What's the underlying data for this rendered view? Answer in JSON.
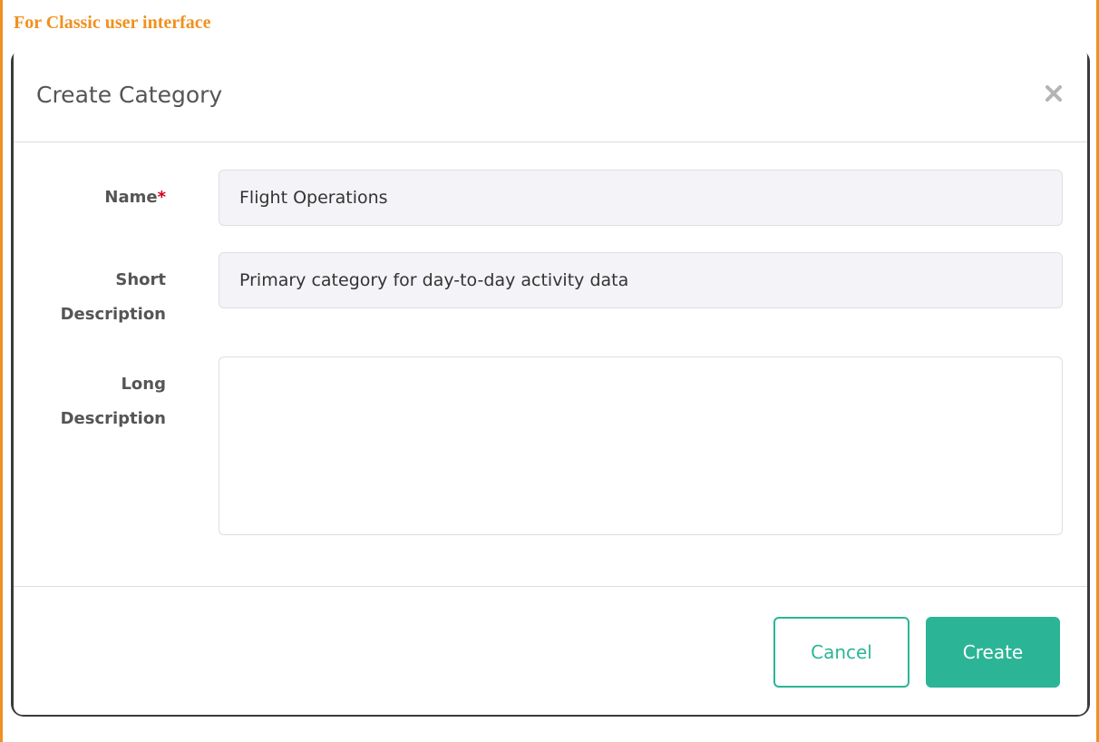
{
  "heading": "For Classic user interface",
  "dialog": {
    "title": "Create Category",
    "close_icon": "close-icon"
  },
  "form": {
    "name": {
      "label": "Name",
      "required_mark": "*",
      "value": "Flight Operations"
    },
    "short_description": {
      "label_line1": "Short",
      "label_line2": "Description",
      "value": "Primary category for day-to-day activity data"
    },
    "long_description": {
      "label_line1": "Long",
      "label_line2": "Description",
      "value": ""
    }
  },
  "footer": {
    "cancel_label": "Cancel",
    "create_label": "Create"
  },
  "colors": {
    "heading": "#f0901e",
    "accent": "#2bb596",
    "required": "#d0021b",
    "label_text": "#555555"
  }
}
